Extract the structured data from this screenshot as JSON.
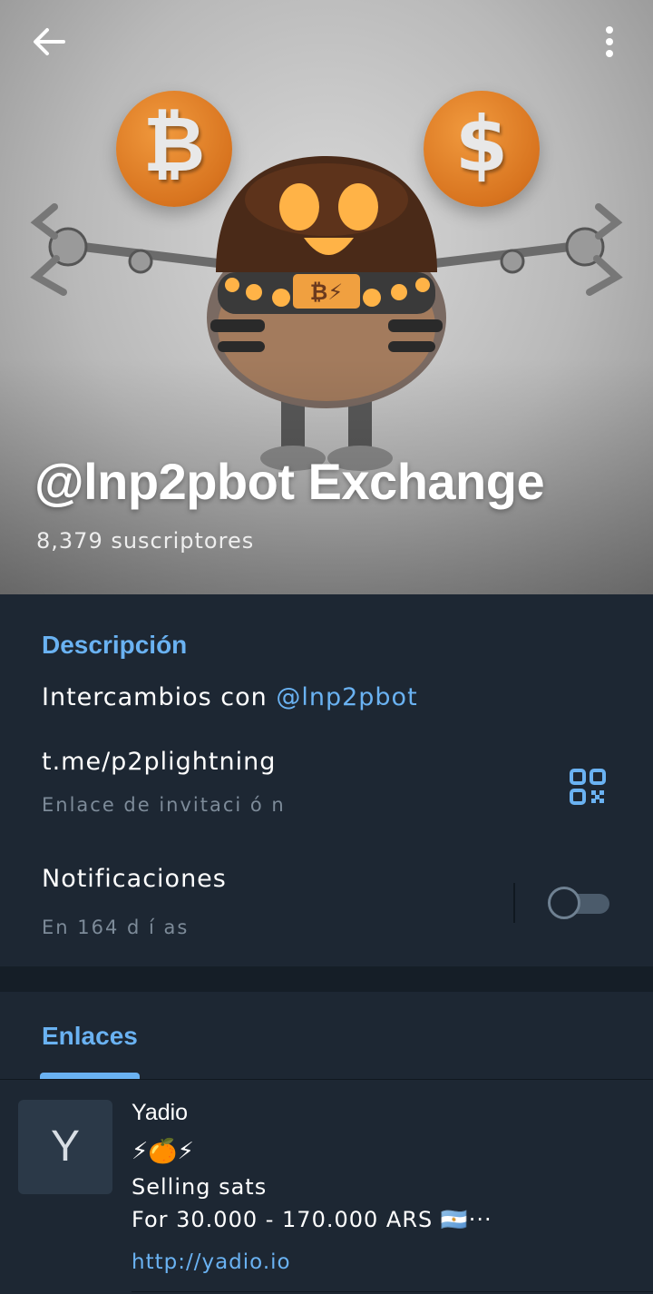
{
  "header": {
    "channel_name": "@lnp2pbot Exchange",
    "subscribers": "8,379 suscriptores",
    "coin_left_symbol": "₿",
    "coin_right_symbol": "$",
    "robot_badge": "₿⚡",
    "back_icon": "arrow-back-icon",
    "menu_icon": "more-vertical-icon"
  },
  "info": {
    "description_label": "Descripción",
    "description_prefix": "Intercambios con ",
    "description_mention": "@lnp2pbot",
    "invite_link": "t.me/p2plightning",
    "invite_link_label": "Enlace de invitaci ó n",
    "qr_icon": "qr-code-icon",
    "notifications_label": "Notificaciones",
    "notifications_sub": "En 164 d í as",
    "notifications_enabled": false
  },
  "links": {
    "tab_label": "Enlaces",
    "items": [
      {
        "thumb_letter": "Y",
        "title": "Yadio",
        "emoji_line": "⚡🍊⚡",
        "line1": "Selling sats",
        "line2": "For 30.000 - 170.000 ARS 🇦🇷···",
        "url": "http://yadio.io"
      }
    ]
  },
  "colors": {
    "accent": "#6ab2f2",
    "background": "#1d2733",
    "coin": "#d8741f"
  }
}
